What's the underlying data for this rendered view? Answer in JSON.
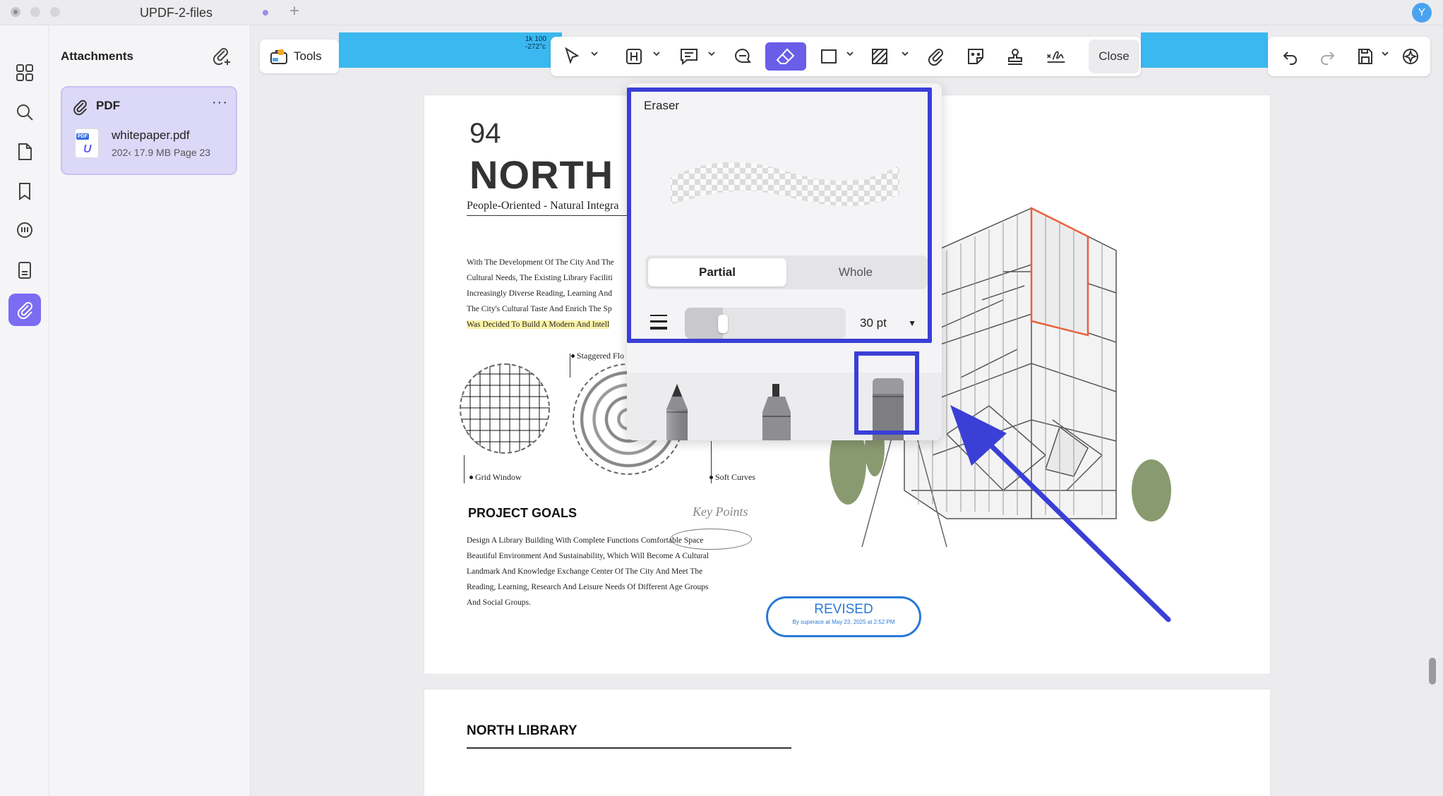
{
  "window": {
    "tab_title": "UPDF-2-files",
    "new_tab": "+",
    "avatar_initial": "Y"
  },
  "rail": {
    "items": [
      "thumbnails-icon",
      "search-icon",
      "pages-icon",
      "bookmark-icon",
      "comments-icon",
      "organize-icon",
      "attachments-icon"
    ],
    "active": "attachments-icon",
    "accent": "#7b6cf2"
  },
  "attachments": {
    "title": "Attachments",
    "card": {
      "type": "PDF",
      "more": "···",
      "file_name": "whitepaper.pdf",
      "file_meta": "202‹  17.9 MB   Page 23",
      "icon_tag": "PDF",
      "icon_letter": "U"
    }
  },
  "toolbar": {
    "tools_label": "Tools",
    "close_label": "Close",
    "strip_text": "1k 100\n-272°c",
    "active_tool": "eraser-icon",
    "accent": "#6a5de8"
  },
  "eraser": {
    "title": "Eraser",
    "mode_options": [
      "Partial",
      "Whole"
    ],
    "selected_mode": "Partial",
    "size_value": "30 pt",
    "size_fraction": 0.22,
    "selected_tip": "eraser-tip",
    "highlight_color": "#3a3fd6"
  },
  "document": {
    "page_number": "94",
    "heading": "NORTH L",
    "subheading": "People-Oriented - Natural Integra",
    "body_lines": [
      "With The Development Of The City And The",
      "Cultural Needs, The Existing Library Faciliti",
      "Increasingly Diverse Reading, Learning And",
      "The City's Cultural Taste And Enrich The Sp"
    ],
    "body_highlight_line": "Was Decided To Build A Modern And Intell",
    "callouts": {
      "staggered": "Staggered Flo",
      "grid_window": "Grid Window",
      "soft_curves": "Soft Curves"
    },
    "goals_title": "PROJECT GOALS",
    "key_points": "Key Points",
    "goals_lines": [
      "Design A Library Building With Complete Functions Comfortable Space",
      "Beautiful Environment And Sustainability, Which Will Become A Cultural",
      "Landmark And Knowledge Exchange Center Of The City And Meet The",
      "Reading, Learning, Research And Leisure Needs Of Different Age Groups",
      "And Social Groups."
    ],
    "stamp_title": "REVISED",
    "stamp_sub": "By superace at May 23, 2025 at 2:52 PM",
    "page2_title": "NORTH LIBRARY"
  }
}
